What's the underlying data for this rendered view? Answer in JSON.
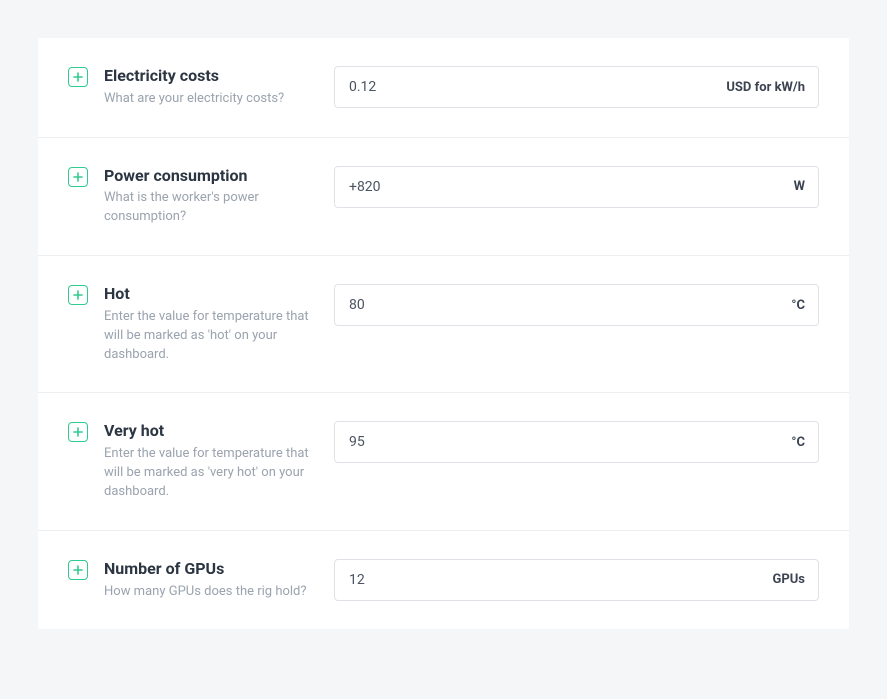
{
  "rows": [
    {
      "id": "electricity",
      "title": "Electricity costs",
      "desc": "What are your electricity costs?",
      "value": "0.12",
      "unit": "USD for kW/h"
    },
    {
      "id": "power",
      "title": "Power consumption",
      "desc": "What is the worker's power consumption?",
      "value": "+820",
      "unit": "W"
    },
    {
      "id": "hot",
      "title": "Hot",
      "desc": "Enter the value for temperature that will be marked as 'hot' on your dashboard.",
      "value": "80",
      "unit": "°C"
    },
    {
      "id": "veryhot",
      "title": "Very hot",
      "desc": "Enter the value for temperature that will be marked as 'very hot' on your dashboard.",
      "value": "95",
      "unit": "°C"
    },
    {
      "id": "gpus",
      "title": "Number of GPUs",
      "desc": "How many GPUs does the rig hold?",
      "value": "12",
      "unit": "GPUs"
    }
  ]
}
